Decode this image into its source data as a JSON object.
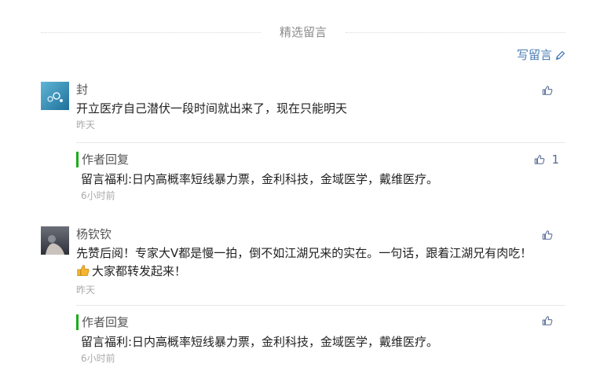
{
  "section": {
    "title": "精选留言",
    "write_label": "写留言"
  },
  "comments": [
    {
      "nickname": "封",
      "content": "开立医疗自己潜伏一段时间就出来了，现在只能明天",
      "time": "昨天",
      "likes": "",
      "reply": {
        "label": "作者回复",
        "content": "留言福利:日内高概率短线暴力票，金利科技，金域医学，戴维医疗。",
        "time": "6小时前",
        "likes": "1"
      }
    },
    {
      "nickname": "杨钦钦",
      "content_line1": "先赞后阅！专家大V都是慢一拍，倒不如江湖兄来的实在。一句话，跟着江湖兄有肉吃！",
      "content_line2": "大家都转发起来！",
      "time": "昨天",
      "likes": "",
      "reply": {
        "label": "作者回复",
        "content": "留言福利:日内高概率短线暴力票，金利科技，金域医学，戴维医疗。",
        "time": "6小时前",
        "likes": ""
      }
    }
  ],
  "colors": {
    "link": "#4a7cb5",
    "reply_bar": "#1aad19",
    "muted": "#aaaaaa"
  },
  "icons": {
    "write": "pencil-icon",
    "like": "thumbs-up-icon",
    "emoji": "thumbs-up-emoji"
  }
}
